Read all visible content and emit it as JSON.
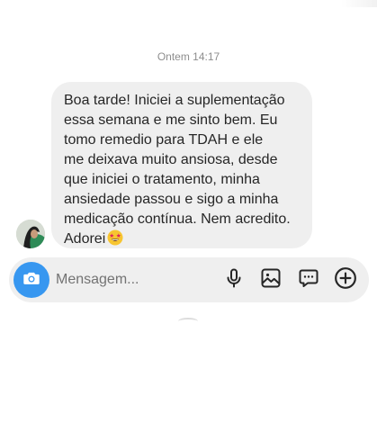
{
  "conversation": {
    "timestamp": "Ontem 14:17",
    "message": {
      "text": "Boa tarde! Iniciei a suplementação\nessa semana e me sinto bem. Eu\ntomo remedio para TDAH e ele\nme deixava muito ansiosa, desde\nque iniciei o tratamento, minha\nansiedade passou e sigo a minha\nmedicação contínua. Nem acredito.\nAdorei",
      "emoji": "star-struck-emoji",
      "sender_avatar": "avatar"
    }
  },
  "composer": {
    "placeholder": "Mensagem...",
    "camera_icon": "camera-icon",
    "tools": [
      "microphone-icon",
      "image-icon",
      "sticker-icon",
      "plus-icon"
    ]
  },
  "colors": {
    "accent": "#3797f0",
    "bubble": "#efefef",
    "text": "#262626",
    "muted": "#8e8e8e"
  }
}
